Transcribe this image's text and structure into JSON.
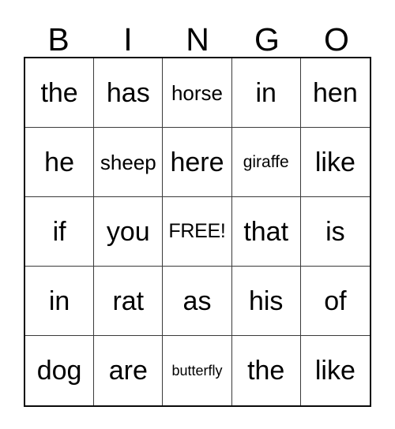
{
  "card": {
    "title": "BINGO",
    "header_letters": [
      "B",
      "I",
      "N",
      "G",
      "O"
    ],
    "free_space_label": "FREE!",
    "colors": {
      "background": "#ffffff",
      "text": "#000000",
      "outer_border": "#0a0a0a",
      "grid_line": "#3b3b3b"
    },
    "grid": {
      "columns": 5,
      "rows": 5,
      "rows_data": [
        {
          "cells": [
            {
              "text": "the",
              "size": "size-lg"
            },
            {
              "text": "has",
              "size": "size-lg"
            },
            {
              "text": "horse",
              "size": "size-sm"
            },
            {
              "text": "in",
              "size": "size-lg"
            },
            {
              "text": "hen",
              "size": "size-lg"
            }
          ]
        },
        {
          "cells": [
            {
              "text": "he",
              "size": "size-lg"
            },
            {
              "text": "sheep",
              "size": "size-sm"
            },
            {
              "text": "here",
              "size": "size-lg"
            },
            {
              "text": "giraffe",
              "size": "size-xs"
            },
            {
              "text": "like",
              "size": "size-lg"
            }
          ]
        },
        {
          "cells": [
            {
              "text": "if",
              "size": "size-lg"
            },
            {
              "text": "you",
              "size": "size-lg"
            },
            {
              "text": "FREE!",
              "size": "size-free"
            },
            {
              "text": "that",
              "size": "size-lg"
            },
            {
              "text": "is",
              "size": "size-lg"
            }
          ]
        },
        {
          "cells": [
            {
              "text": "in",
              "size": "size-lg"
            },
            {
              "text": "rat",
              "size": "size-lg"
            },
            {
              "text": "as",
              "size": "size-lg"
            },
            {
              "text": "his",
              "size": "size-lg"
            },
            {
              "text": "of",
              "size": "size-lg"
            }
          ]
        },
        {
          "cells": [
            {
              "text": "dog",
              "size": "size-lg"
            },
            {
              "text": "are",
              "size": "size-lg"
            },
            {
              "text": "butterfly",
              "size": "size-xxs"
            },
            {
              "text": "the",
              "size": "size-lg"
            },
            {
              "text": "like",
              "size": "size-lg"
            }
          ]
        }
      ]
    }
  }
}
